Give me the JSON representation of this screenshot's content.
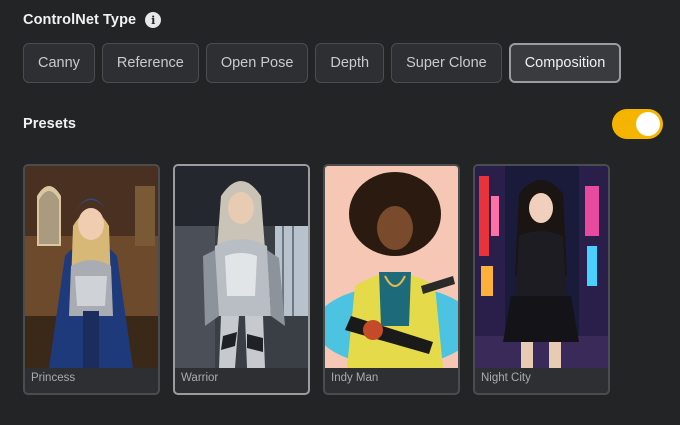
{
  "controlnet": {
    "title": "ControlNet Type",
    "info_icon": "info-icon",
    "tabs": [
      {
        "label": "Canny",
        "active": false
      },
      {
        "label": "Reference",
        "active": false
      },
      {
        "label": "Open Pose",
        "active": false
      },
      {
        "label": "Depth",
        "active": false
      },
      {
        "label": "Super Clone",
        "active": false
      },
      {
        "label": "Composition",
        "active": true
      }
    ]
  },
  "presets": {
    "title": "Presets",
    "toggle_on": true,
    "toggle_color": "#f5b400",
    "items": [
      {
        "label": "Princess",
        "selected": false
      },
      {
        "label": "Warrior",
        "selected": true
      },
      {
        "label": "Indy Man",
        "selected": false
      },
      {
        "label": "Night City",
        "selected": false
      }
    ]
  }
}
